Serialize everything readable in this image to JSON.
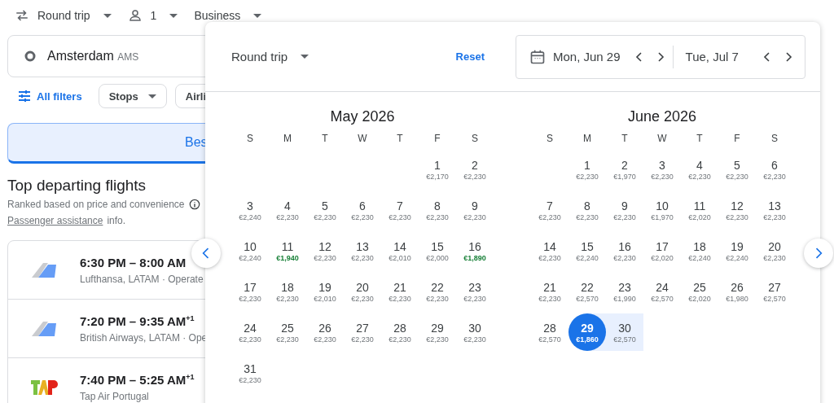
{
  "top_bar": {
    "trip_type": "Round trip",
    "passengers": "1",
    "cabin": "Business"
  },
  "search": {
    "origin": "Amsterdam",
    "origin_code": "AMS"
  },
  "filters": {
    "all_filters": "All filters",
    "chips": [
      "Stops",
      "Airli"
    ]
  },
  "sort_tabs": [
    {
      "label": "Bes",
      "selected": true
    }
  ],
  "section": {
    "title": "Top departing flights",
    "subtitle": "Ranked based on price and convenience",
    "link": "Passenger assistance",
    "link_suffix": "info."
  },
  "flights": [
    {
      "kind": "tail",
      "times": "6:30 PM – 8:00 AM",
      "airlines": "Lufthansa, LATAM · Operate"
    },
    {
      "kind": "tail",
      "times": "7:20 PM – 9:35 AM$^{+1}$",
      "airlines": "British Airways, LATAM · Ope"
    },
    {
      "kind": "tap",
      "times": "7:40 PM – 5:25 AM$^{+1}$",
      "airlines": "Tap Air Portugal"
    }
  ],
  "date_picker": {
    "trip_type": "Round trip",
    "reset": "Reset",
    "departure": "Mon, Jun 29",
    "return": "Tue, Jul 7",
    "months": [
      {
        "title": "May 2026",
        "weekdays": [
          "S",
          "M",
          "T",
          "W",
          "T",
          "F",
          "S"
        ],
        "weeks": [
          [
            {
              "kind": "blank"
            },
            {
              "kind": "blank"
            },
            {
              "kind": "blank"
            },
            {
              "kind": "blank"
            },
            {
              "kind": "blank"
            },
            {
              "kind": "day",
              "day": "1",
              "price": "€2,170",
              "low": false,
              "selected": false,
              "in_range": false
            },
            {
              "kind": "day",
              "day": "2",
              "price": "€2,230",
              "low": false,
              "selected": false,
              "in_range": false
            }
          ],
          [
            {
              "kind": "day",
              "day": "3",
              "price": "€2,240",
              "low": false,
              "selected": false,
              "in_range": false
            },
            {
              "kind": "day",
              "day": "4",
              "price": "€2,230",
              "low": false,
              "selected": false,
              "in_range": false
            },
            {
              "kind": "day",
              "day": "5",
              "price": "€2,230",
              "low": false,
              "selected": false,
              "in_range": false
            },
            {
              "kind": "day",
              "day": "6",
              "price": "€2,230",
              "low": false,
              "selected": false,
              "in_range": false
            },
            {
              "kind": "day",
              "day": "7",
              "price": "€2,230",
              "low": false,
              "selected": false,
              "in_range": false
            },
            {
              "kind": "day",
              "day": "8",
              "price": "€2,230",
              "low": false,
              "selected": false,
              "in_range": false
            },
            {
              "kind": "day",
              "day": "9",
              "price": "€2,230",
              "low": false,
              "selected": false,
              "in_range": false
            }
          ],
          [
            {
              "kind": "day",
              "day": "10",
              "price": "€2,240",
              "low": false,
              "selected": false,
              "in_range": false
            },
            {
              "kind": "day",
              "day": "11",
              "price": "€1,940",
              "low": true,
              "selected": false,
              "in_range": false
            },
            {
              "kind": "day",
              "day": "12",
              "price": "€2,230",
              "low": false,
              "selected": false,
              "in_range": false
            },
            {
              "kind": "day",
              "day": "13",
              "price": "€2,230",
              "low": false,
              "selected": false,
              "in_range": false
            },
            {
              "kind": "day",
              "day": "14",
              "price": "€2,010",
              "low": false,
              "selected": false,
              "in_range": false
            },
            {
              "kind": "day",
              "day": "15",
              "price": "€2,000",
              "low": false,
              "selected": false,
              "in_range": false
            },
            {
              "kind": "day",
              "day": "16",
              "price": "€1,890",
              "low": true,
              "selected": false,
              "in_range": false
            }
          ],
          [
            {
              "kind": "day",
              "day": "17",
              "price": "€2,230",
              "low": false,
              "selected": false,
              "in_range": false
            },
            {
              "kind": "day",
              "day": "18",
              "price": "€2,230",
              "low": false,
              "selected": false,
              "in_range": false
            },
            {
              "kind": "day",
              "day": "19",
              "price": "€2,010",
              "low": false,
              "selected": false,
              "in_range": false
            },
            {
              "kind": "day",
              "day": "20",
              "price": "€2,230",
              "low": false,
              "selected": false,
              "in_range": false
            },
            {
              "kind": "day",
              "day": "21",
              "price": "€2,230",
              "low": false,
              "selected": false,
              "in_range": false
            },
            {
              "kind": "day",
              "day": "22",
              "price": "€2,230",
              "low": false,
              "selected": false,
              "in_range": false
            },
            {
              "kind": "day",
              "day": "23",
              "price": "€2,230",
              "low": false,
              "selected": false,
              "in_range": false
            }
          ],
          [
            {
              "kind": "day",
              "day": "24",
              "price": "€2,230",
              "low": false,
              "selected": false,
              "in_range": false
            },
            {
              "kind": "day",
              "day": "25",
              "price": "€2,230",
              "low": false,
              "selected": false,
              "in_range": false
            },
            {
              "kind": "day",
              "day": "26",
              "price": "€2,230",
              "low": false,
              "selected": false,
              "in_range": false
            },
            {
              "kind": "day",
              "day": "27",
              "price": "€2,230",
              "low": false,
              "selected": false,
              "in_range": false
            },
            {
              "kind": "day",
              "day": "28",
              "price": "€2,230",
              "low": false,
              "selected": false,
              "in_range": false
            },
            {
              "kind": "day",
              "day": "29",
              "price": "€2,230",
              "low": false,
              "selected": false,
              "in_range": false
            },
            {
              "kind": "day",
              "day": "30",
              "price": "€2,230",
              "low": false,
              "selected": false,
              "in_range": false
            }
          ],
          [
            {
              "kind": "day",
              "day": "31",
              "price": "€2,230",
              "low": false,
              "selected": false,
              "in_range": false
            }
          ]
        ]
      },
      {
        "title": "June 2026",
        "weekdays": [
          "S",
          "M",
          "T",
          "W",
          "T",
          "F",
          "S"
        ],
        "weeks": [
          [
            {
              "kind": "blank"
            },
            {
              "kind": "day",
              "day": "1",
              "price": "€2,230",
              "low": false,
              "selected": false,
              "in_range": false
            },
            {
              "kind": "day",
              "day": "2",
              "price": "€1,970",
              "low": false,
              "selected": false,
              "in_range": false
            },
            {
              "kind": "day",
              "day": "3",
              "price": "€2,230",
              "low": false,
              "selected": false,
              "in_range": false
            },
            {
              "kind": "day",
              "day": "4",
              "price": "€2,230",
              "low": false,
              "selected": false,
              "in_range": false
            },
            {
              "kind": "day",
              "day": "5",
              "price": "€2,230",
              "low": false,
              "selected": false,
              "in_range": false
            },
            {
              "kind": "day",
              "day": "6",
              "price": "€2,230",
              "low": false,
              "selected": false,
              "in_range": false
            }
          ],
          [
            {
              "kind": "day",
              "day": "7",
              "price": "€2,230",
              "low": false,
              "selected": false,
              "in_range": false
            },
            {
              "kind": "day",
              "day": "8",
              "price": "€2,230",
              "low": false,
              "selected": false,
              "in_range": false
            },
            {
              "kind": "day",
              "day": "9",
              "price": "€2,230",
              "low": false,
              "selected": false,
              "in_range": false
            },
            {
              "kind": "day",
              "day": "10",
              "price": "€1,970",
              "low": false,
              "selected": false,
              "in_range": false
            },
            {
              "kind": "day",
              "day": "11",
              "price": "€2,020",
              "low": false,
              "selected": false,
              "in_range": false
            },
            {
              "kind": "day",
              "day": "12",
              "price": "€2,230",
              "low": false,
              "selected": false,
              "in_range": false
            },
            {
              "kind": "day",
              "day": "13",
              "price": "€2,230",
              "low": false,
              "selected": false,
              "in_range": false
            }
          ],
          [
            {
              "kind": "day",
              "day": "14",
              "price": "€2,230",
              "low": false,
              "selected": false,
              "in_range": false
            },
            {
              "kind": "day",
              "day": "15",
              "price": "€2,240",
              "low": false,
              "selected": false,
              "in_range": false
            },
            {
              "kind": "day",
              "day": "16",
              "price": "€2,230",
              "low": false,
              "selected": false,
              "in_range": false
            },
            {
              "kind": "day",
              "day": "17",
              "price": "€2,020",
              "low": false,
              "selected": false,
              "in_range": false
            },
            {
              "kind": "day",
              "day": "18",
              "price": "€2,240",
              "low": false,
              "selected": false,
              "in_range": false
            },
            {
              "kind": "day",
              "day": "19",
              "price": "€2,240",
              "low": false,
              "selected": false,
              "in_range": false
            },
            {
              "kind": "day",
              "day": "20",
              "price": "€2,230",
              "low": false,
              "selected": false,
              "in_range": false
            }
          ],
          [
            {
              "kind": "day",
              "day": "21",
              "price": "€2,230",
              "low": false,
              "selected": false,
              "in_range": false
            },
            {
              "kind": "day",
              "day": "22",
              "price": "€2,570",
              "low": false,
              "selected": false,
              "in_range": false
            },
            {
              "kind": "day",
              "day": "23",
              "price": "€1,990",
              "low": false,
              "selected": false,
              "in_range": false
            },
            {
              "kind": "day",
              "day": "24",
              "price": "€2,570",
              "low": false,
              "selected": false,
              "in_range": false
            },
            {
              "kind": "day",
              "day": "25",
              "price": "€2,020",
              "low": false,
              "selected": false,
              "in_range": false
            },
            {
              "kind": "day",
              "day": "26",
              "price": "€1,980",
              "low": false,
              "selected": false,
              "in_range": false
            },
            {
              "kind": "day",
              "day": "27",
              "price": "€2,570",
              "low": false,
              "selected": false,
              "in_range": false
            }
          ],
          [
            {
              "kind": "day",
              "day": "28",
              "price": "€2,570",
              "low": false,
              "selected": false,
              "in_range": false
            },
            {
              "kind": "day",
              "day": "29",
              "price": "€1,860",
              "low": false,
              "selected": true,
              "in_range": false
            },
            {
              "kind": "day",
              "day": "30",
              "price": "€2,570",
              "low": false,
              "selected": false,
              "in_range": true
            }
          ]
        ]
      }
    ]
  }
}
